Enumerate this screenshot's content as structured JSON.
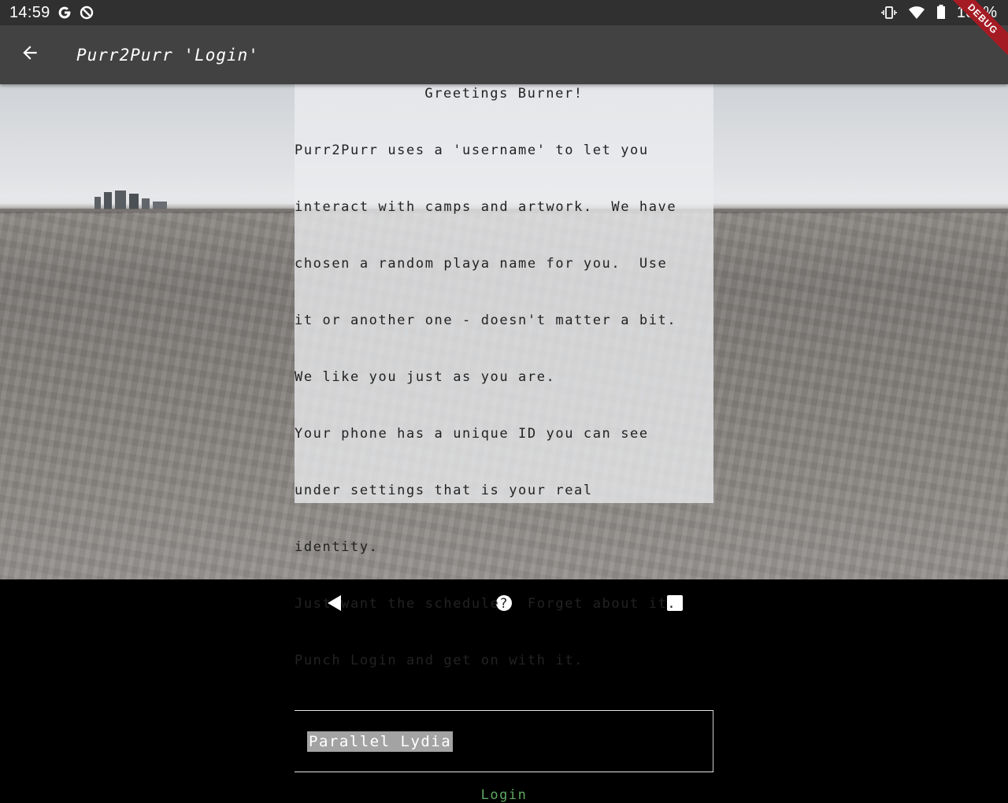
{
  "status_bar": {
    "time": "14:59",
    "battery": "100%",
    "icons": [
      "google-g-icon",
      "data-saver-icon",
      "vibrate-icon",
      "wifi-icon",
      "battery-icon"
    ]
  },
  "debug_banner": "DEBUG",
  "app_bar": {
    "title": "Purr2Purr 'Login'",
    "back_icon": "arrow-left-icon"
  },
  "login": {
    "greeting": "Greetings Burner!",
    "intro_lines": [
      "Purr2Purr uses a 'username' to let you",
      "interact with camps and artwork.  We have",
      "chosen a random playa name for you.  Use",
      "it or another one - doesn't matter a bit.",
      "We like you just as you are.",
      "Your phone has a unique ID you can see",
      "under settings that is your real",
      "identity.",
      "Just want the schedule?  Forget about it.",
      "Punch Login and get on with it."
    ],
    "username_value": "Parallel Lydia",
    "login_label": "Login"
  },
  "colors": {
    "app_bar": "#424242",
    "status_bar": "#303030",
    "login_accent": "#5fa862",
    "debug_ribbon": "#a51b24"
  },
  "nav_bar": {
    "icons": [
      "back-triangle-icon",
      "home-circle-icon",
      "recents-square-icon"
    ]
  }
}
